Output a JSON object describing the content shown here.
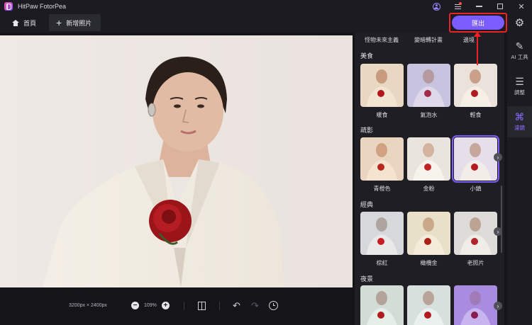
{
  "app": {
    "title": "HitPaw FotorPea"
  },
  "toolbar": {
    "home_label": "首頁",
    "add_label": "新增照片",
    "export_label": "匯出"
  },
  "canvas": {
    "dimensions": "3200px × 2400px",
    "zoom": "109%"
  },
  "panel": {
    "top_categories": [
      "怪物未來主義",
      "變暗轉計畫",
      "邊境"
    ],
    "sections": [
      {
        "title": "美食",
        "items": [
          "暖食",
          "氣泡水",
          "輕食"
        ]
      },
      {
        "title": "疏影",
        "items": [
          "青橙色",
          "金粉",
          "小鎮"
        ]
      },
      {
        "title": "經典",
        "items": [
          "棕紅",
          "橄欖金",
          "老照片"
        ]
      },
      {
        "title": "夜景",
        "items": [
          "",
          "",
          ""
        ]
      }
    ],
    "selected": "小鎮"
  },
  "rail": {
    "items": [
      "AI 工具",
      "調整",
      "濾鏡"
    ],
    "active": "濾鏡"
  },
  "colors": {
    "accent": "#7a5cff",
    "highlight": "#e22222"
  }
}
